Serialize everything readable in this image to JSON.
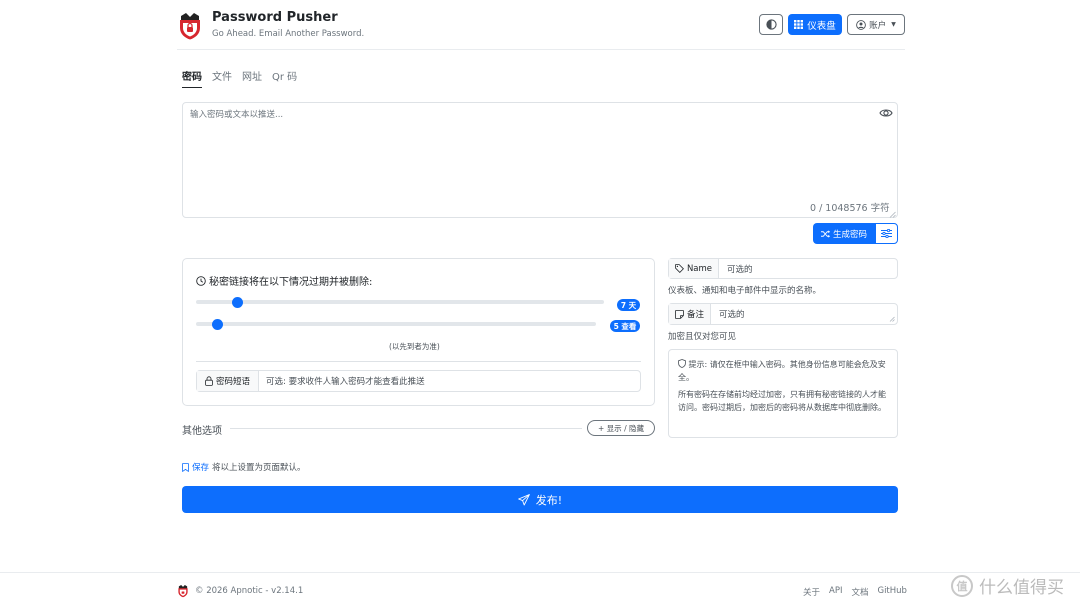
{
  "header": {
    "title": "Password Pusher",
    "subtitle": "Go Ahead. Email Another Password.",
    "dashboard_label": "仪表盘",
    "account_label": "账户"
  },
  "tabs": [
    {
      "label": "密码",
      "active": true
    },
    {
      "label": "文件",
      "active": false
    },
    {
      "label": "网址",
      "active": false
    },
    {
      "label": "Qr 码",
      "active": false
    }
  ],
  "payload": {
    "placeholder": "输入密码或文本以推送...",
    "char_count": "0 / 1048576 字符",
    "generate_label": "生成密码"
  },
  "expiration": {
    "title": "秘密链接将在以下情况过期并被删除:",
    "days_badge": "7 天",
    "views_badge": "5 查看",
    "days_fraction": 0.09,
    "views_fraction": 0.04,
    "first_note": "(以先到者为准)",
    "passphrase_label": "密码短语",
    "passphrase_placeholder": "可选: 要求收件人输入密码才能查看此推送"
  },
  "other_options": {
    "label": "其他选项",
    "toggle_label": "+ 显示 / 隐藏"
  },
  "name_field": {
    "label": "Name",
    "placeholder": "可选的",
    "help": "仪表板、通知和电子邮件中显示的名称。"
  },
  "note_field": {
    "label": "备注",
    "placeholder": "可选的",
    "help": "加密且仅对您可见"
  },
  "tip": {
    "line1": "提示: 请仅在框中输入密码。其他身份信息可能会危及安全。",
    "line2": "所有密码在存储前均经过加密，只有拥有秘密链接的人才能访问。密码过期后，加密后的密码将从数据库中彻底删除。"
  },
  "save": {
    "link": "保存",
    "text": "将以上设置为页面默认。"
  },
  "publish_label": "发布!",
  "footer": {
    "copyright": "© 2026 Apnotic - v2.14.1",
    "links": [
      "关于",
      "API",
      "文档",
      "GitHub"
    ],
    "watermark": "什么值得买",
    "watermark_badge": "值"
  },
  "colors": {
    "primary": "#0d6efd",
    "logo_red": "#d7262e"
  }
}
